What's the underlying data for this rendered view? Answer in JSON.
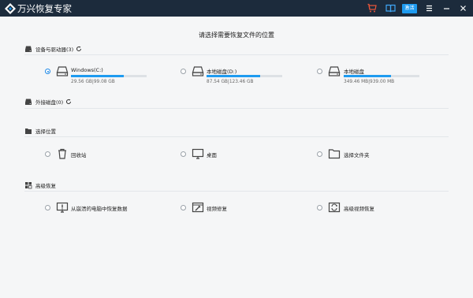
{
  "app": {
    "title": "万兴恢复专家",
    "activate_label": "激活"
  },
  "titlebar_icons": [
    "cart-icon",
    "book-icon",
    "menu-icon",
    "minimize-icon",
    "close-icon"
  ],
  "heading": "请选择需要恢复文件的位置",
  "sections": {
    "devices": {
      "title": "设备与驱动器(3)"
    },
    "external": {
      "title": "外接磁盘(0)"
    },
    "location": {
      "title": "选择位置"
    },
    "advanced": {
      "title": "高级恢复"
    }
  },
  "drives": [
    {
      "name": "Windows(C:)",
      "size": "29.56 GB|99.08 GB",
      "used_fraction": 0.7,
      "selected": true
    },
    {
      "name": "本地磁盘(D:)",
      "size": "87.54 GB|123.46 GB",
      "used_fraction": 0.71,
      "selected": false
    },
    {
      "name": "本地磁盘",
      "size": "349.46 MB|939.00 MB",
      "used_fraction": 0.63,
      "selected": false
    }
  ],
  "locations": [
    {
      "label": "回收站",
      "icon": "trash-icon"
    },
    {
      "label": "桌面",
      "icon": "monitor-icon"
    },
    {
      "label": "选择文件夹",
      "icon": "folder-icon"
    }
  ],
  "advanced": [
    {
      "label": "从崩溃的电脑中恢复数据",
      "icon": "crashed-pc-icon"
    },
    {
      "label": "视频修复",
      "icon": "video-repair-icon"
    },
    {
      "label": "高级视频恢复",
      "icon": "advanced-video-icon"
    }
  ],
  "colors": {
    "titlebar": "#1c2b3c",
    "accent": "#1e9bf0",
    "background": "#f5f6f7"
  }
}
